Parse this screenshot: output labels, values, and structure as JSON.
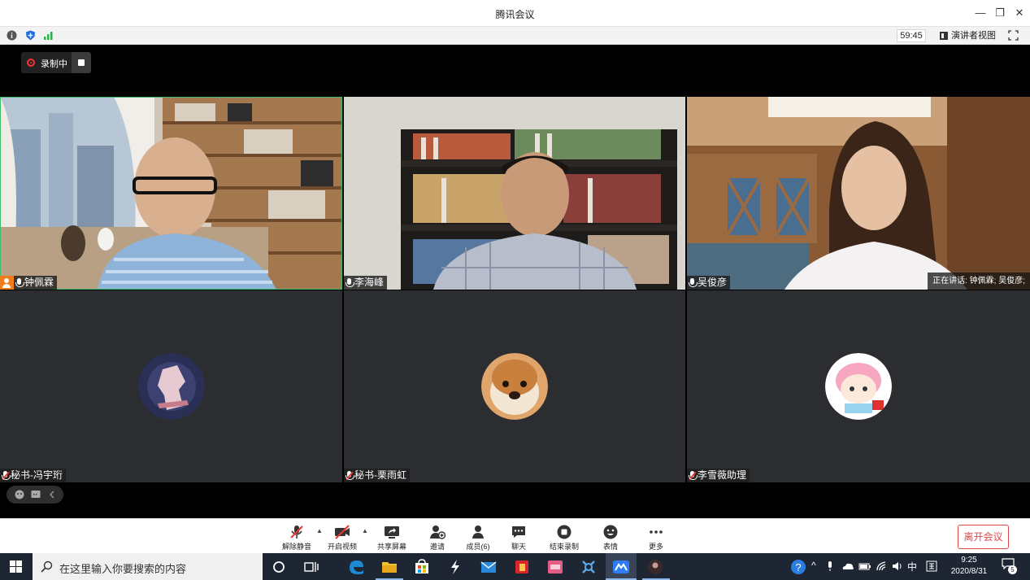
{
  "window": {
    "title": "腾讯会议",
    "min_glyph": "—",
    "restore_glyph": "❐",
    "close_glyph": "✕"
  },
  "infobar": {
    "timer": "59:45",
    "speaker_view": "演讲者视图"
  },
  "recording": {
    "label": "录制中"
  },
  "tiles": [
    {
      "name": "钟佩霖",
      "muted": false,
      "host": true
    },
    {
      "name": "李海峰",
      "muted": false
    },
    {
      "name": "吴俊彦",
      "muted": false
    },
    {
      "name": "秘书-冯宇珩",
      "muted": true
    },
    {
      "name": "秘书-栗雨虹",
      "muted": true
    },
    {
      "name": "李雪薇助理",
      "muted": true
    }
  ],
  "speaking_now": "正在讲话: 钟佩霖; 吴俊彦;",
  "toolbar": {
    "unmute": "解除静音",
    "start_video": "开启视频",
    "share_screen": "共享屏幕",
    "invite": "邀请",
    "members": "成员(6)",
    "chat": "聊天",
    "end_recording": "结束录制",
    "reactions": "表情",
    "more": "更多",
    "leave": "离开会议"
  },
  "taskbar": {
    "search_placeholder": "在这里输入你要搜索的内容",
    "ime": "中",
    "time": "9:25",
    "date": "2020/8/31",
    "notifications": "5"
  },
  "colors": {
    "accent_green": "#3fbb6c",
    "leave_red": "#e04848",
    "host_orange": "#f07c1b"
  }
}
